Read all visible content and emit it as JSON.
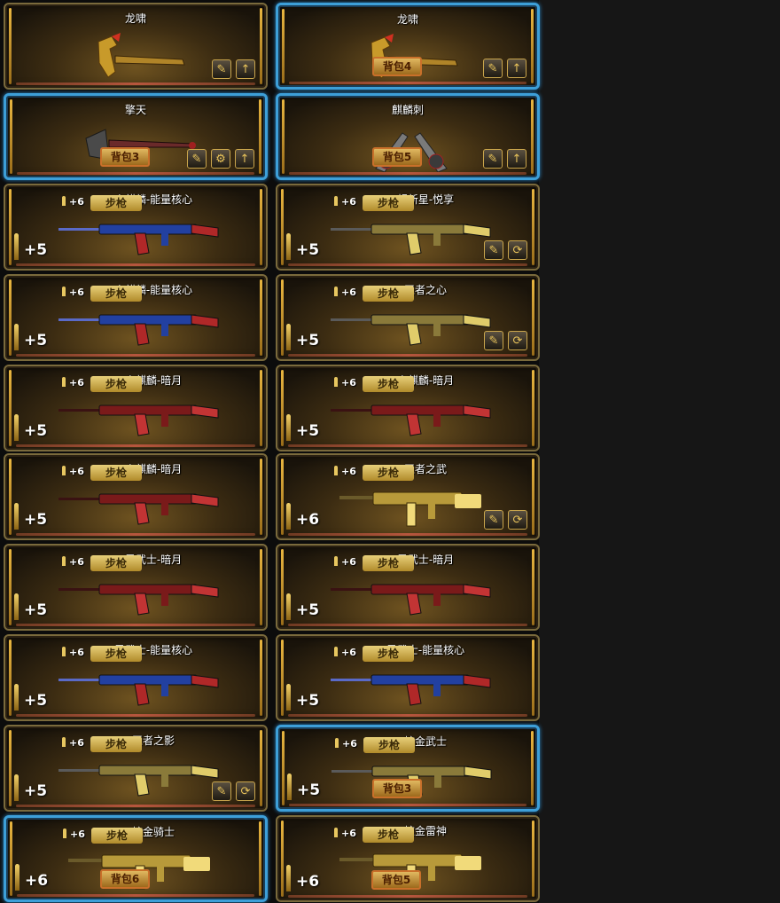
{
  "cards": [
    {
      "name": "龙啸",
      "type": "",
      "ammo": "",
      "level": "",
      "bag": "",
      "selected": false,
      "kind": "melee",
      "buttons": [
        "wrench-icon",
        "upgrade-arrow-icon"
      ]
    },
    {
      "name": "龙啸",
      "type": "",
      "ammo": "",
      "level": "",
      "bag": "背包4",
      "selected": true,
      "kind": "melee",
      "buttons": [
        "wrench-icon",
        "upgrade-arrow-icon"
      ]
    },
    {
      "name": "擎天",
      "type": "",
      "ammo": "",
      "level": "",
      "bag": "背包3",
      "selected": true,
      "kind": "shovel",
      "buttons": [
        "wrench-icon",
        "gear-icon",
        "upgrade-arrow-icon"
      ]
    },
    {
      "name": "麒麟刺",
      "type": "",
      "ammo": "",
      "level": "",
      "bag": "背包5",
      "selected": true,
      "kind": "dual",
      "buttons": [
        "wrench-icon",
        "upgrade-arrow-icon"
      ]
    },
    {
      "name": "火麒麟-能量核心",
      "type": "步枪",
      "ammo": "+6",
      "level": "+5",
      "bag": "",
      "selected": false,
      "kind": "rifle-blue",
      "buttons": []
    },
    {
      "name": "超新星-悦享",
      "type": "步枪",
      "ammo": "+6",
      "level": "+5",
      "bag": "",
      "selected": false,
      "kind": "rifle-gold",
      "buttons": [
        "wrench-icon",
        "swap-icon"
      ]
    },
    {
      "name": "火麒麟-能量核心",
      "type": "步枪",
      "ammo": "+6",
      "level": "+5",
      "bag": "",
      "selected": false,
      "kind": "rifle-blue",
      "buttons": []
    },
    {
      "name": "王者之心",
      "type": "步枪",
      "ammo": "+6",
      "level": "+5",
      "bag": "",
      "selected": false,
      "kind": "rifle-gold",
      "buttons": [
        "wrench-icon",
        "swap-icon"
      ]
    },
    {
      "name": "火麒麟-暗月",
      "type": "步枪",
      "ammo": "+6",
      "level": "+5",
      "bag": "",
      "selected": false,
      "kind": "rifle-red",
      "buttons": []
    },
    {
      "name": "火麒麟-暗月",
      "type": "步枪",
      "ammo": "+6",
      "level": "+5",
      "bag": "",
      "selected": false,
      "kind": "rifle-red",
      "buttons": []
    },
    {
      "name": "火麒麟-暗月",
      "type": "步枪",
      "ammo": "+6",
      "level": "+5",
      "bag": "",
      "selected": false,
      "kind": "rifle-red",
      "buttons": []
    },
    {
      "name": "王者之武",
      "type": "步枪",
      "ammo": "+6",
      "level": "+6",
      "bag": "",
      "selected": false,
      "kind": "m4-gold",
      "buttons": [
        "wrench-icon",
        "swap-icon"
      ]
    },
    {
      "name": "黑武士-暗月",
      "type": "步枪",
      "ammo": "+6",
      "level": "+5",
      "bag": "",
      "selected": false,
      "kind": "rifle-red",
      "buttons": []
    },
    {
      "name": "黑武士-暗月",
      "type": "步枪",
      "ammo": "+6",
      "level": "+5",
      "bag": "",
      "selected": false,
      "kind": "rifle-red",
      "buttons": []
    },
    {
      "name": "黑武士-能量核心",
      "type": "步枪",
      "ammo": "+6",
      "level": "+5",
      "bag": "",
      "selected": false,
      "kind": "rifle-blue",
      "buttons": []
    },
    {
      "name": "黑武士-能量核心",
      "type": "步枪",
      "ammo": "+6",
      "level": "+5",
      "bag": "",
      "selected": false,
      "kind": "rifle-blue",
      "buttons": []
    },
    {
      "name": "王者之影",
      "type": "步枪",
      "ammo": "+6",
      "level": "+5",
      "bag": "",
      "selected": false,
      "kind": "rifle-gold",
      "buttons": [
        "wrench-icon",
        "swap-icon"
      ]
    },
    {
      "name": "炫金武士",
      "type": "步枪",
      "ammo": "+6",
      "level": "+5",
      "bag": "背包3",
      "selected": true,
      "kind": "rifle-gold",
      "buttons": []
    },
    {
      "name": "炫金骑士",
      "type": "步枪",
      "ammo": "+6",
      "level": "+6",
      "bag": "背包6",
      "selected": true,
      "kind": "m4-gold",
      "buttons": []
    },
    {
      "name": "炫金雷神",
      "type": "步枪",
      "ammo": "+6",
      "level": "+6",
      "bag": "背包5",
      "selected": false,
      "kind": "m4-gold",
      "buttons": []
    }
  ],
  "colors": {
    "selected_border": "#3d9fd8",
    "gold": "#e8c35a",
    "blue_skin": "#2846a8",
    "red_skin": "#9a2020"
  }
}
